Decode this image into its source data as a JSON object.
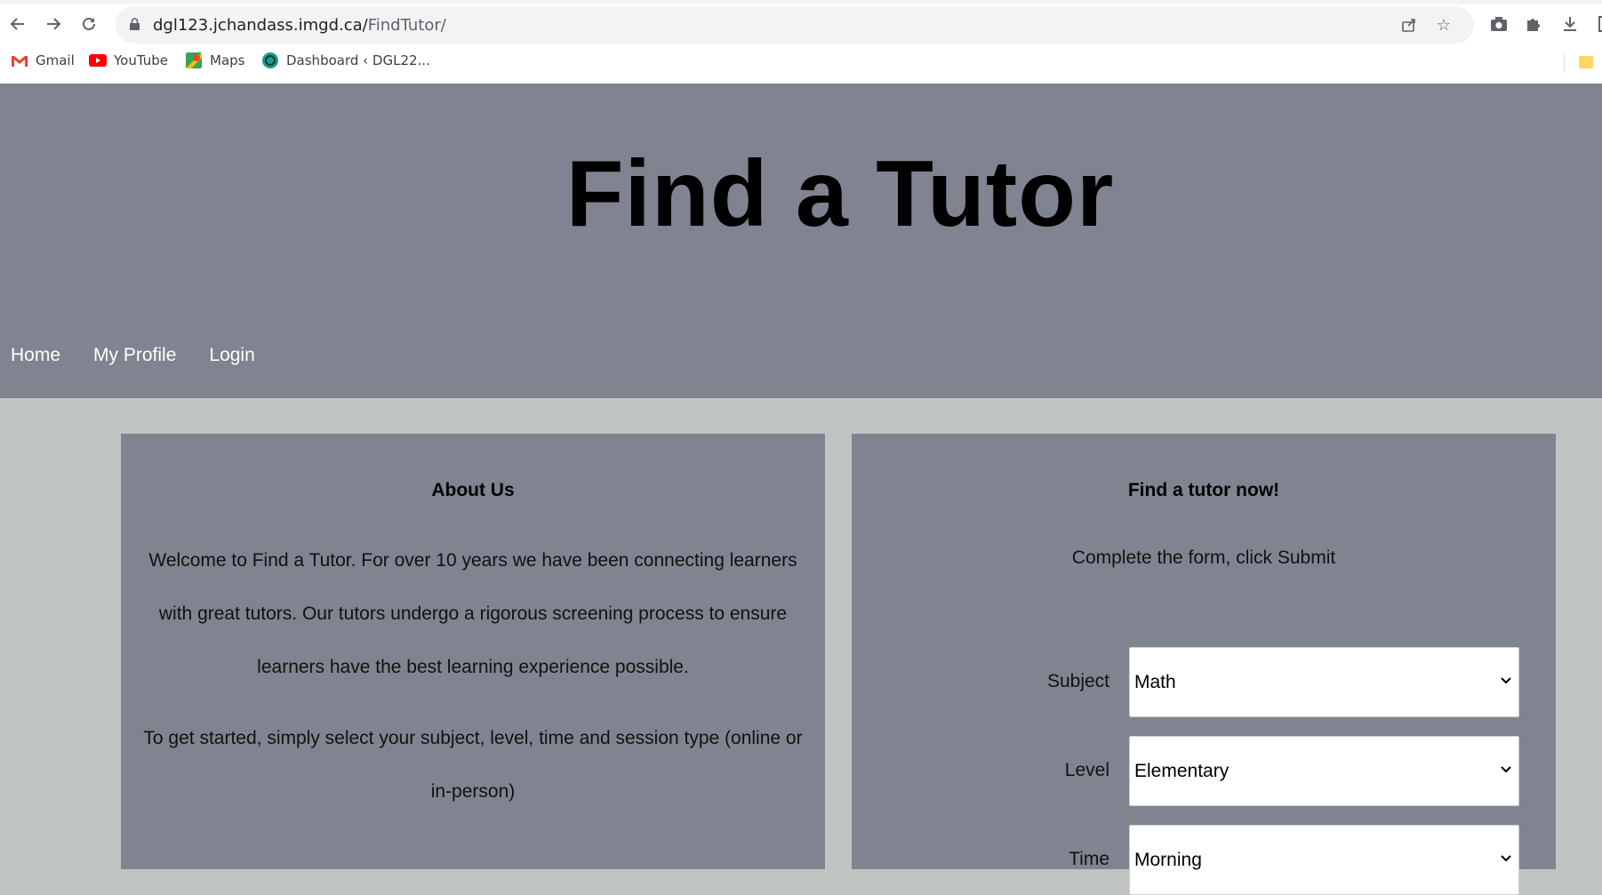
{
  "browser": {
    "url_host": "dgl123.jchandass.imgd.ca/",
    "url_path": "FindTutor/",
    "bookmarks": [
      {
        "label": "Gmail"
      },
      {
        "label": "YouTube"
      },
      {
        "label": "Maps"
      },
      {
        "label": "Dashboard ‹ DGL22..."
      }
    ]
  },
  "site": {
    "title": "Find a Tutor",
    "nav": [
      "Home",
      "My Profile",
      "Login"
    ]
  },
  "about": {
    "heading": "About Us",
    "paragraph1": "Welcome to Find a Tutor. For over 10 years we have been connecting learners with great tutors. Our tutors undergo a rigorous screening process to ensure learners have the best learning experience possible.",
    "paragraph2": "To get started, simply select your subject, level, time and session type (online or in-person)"
  },
  "find": {
    "heading": "Find a tutor now!",
    "subtitle": "Complete the form, click Submit",
    "fields": [
      {
        "label": "Subject",
        "value": "Math"
      },
      {
        "label": "Level",
        "value": "Elementary"
      },
      {
        "label": "Time",
        "value": "Morning"
      }
    ]
  },
  "colors": {
    "header_bg": "#7f8490",
    "page_bg": "#c0c4c0",
    "panel_bg": "#7f8490",
    "nav_text": "#ffffff"
  }
}
